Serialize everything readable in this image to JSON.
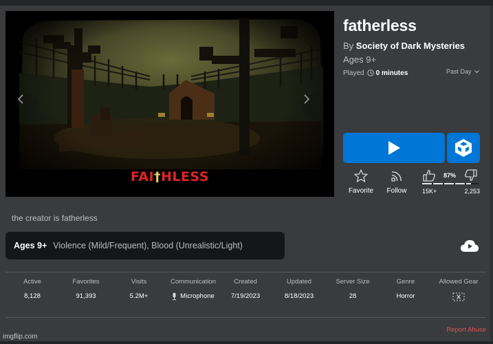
{
  "thumbnail": {
    "title_left": "FAI",
    "title_cross": "†",
    "title_right": "HLESS",
    "prev_icon": "chevron-left-icon",
    "next_icon": "chevron-right-icon"
  },
  "game": {
    "title": "fatherless",
    "by_prefix": "By",
    "creator": "Society of Dark Mysteries",
    "age_rating": "Ages 9+",
    "played_label": "Played",
    "played_value": "0 minutes",
    "period_select": "Past Day"
  },
  "actions": {
    "play_icon": "play-icon",
    "vr_icon": "vr-cube-icon",
    "favorite_label": "Favorite",
    "follow_label": "Follow",
    "upvote_percent": "87%",
    "upvote_fraction": 0.87,
    "upvotes": "15K+",
    "downvotes": "2,253"
  },
  "description": "the creator is fatherless",
  "content_rating": {
    "age": "Ages 9+",
    "descriptors": "Violence (Mild/Frequent), Blood (Unrealistic/Light)"
  },
  "stats": [
    {
      "label": "Active",
      "value": "8,128"
    },
    {
      "label": "Favorites",
      "value": "91,393"
    },
    {
      "label": "Visits",
      "value": "5.2M+"
    },
    {
      "label": "Communication",
      "value": "Microphone"
    },
    {
      "label": "Created",
      "value": "7/19/2023"
    },
    {
      "label": "Updated",
      "value": "8/18/2023"
    },
    {
      "label": "Server Size",
      "value": "28"
    },
    {
      "label": "Genre",
      "value": "Horror"
    },
    {
      "label": "Allowed Gear",
      "value": ""
    }
  ],
  "footer": {
    "report_label": "Report Abuse",
    "watermark": "imgflip.com"
  },
  "colors": {
    "background": "#393b3d",
    "primary_button": "#0076d6",
    "report_link": "#e25451",
    "thumbnail_title": "#e02424"
  }
}
